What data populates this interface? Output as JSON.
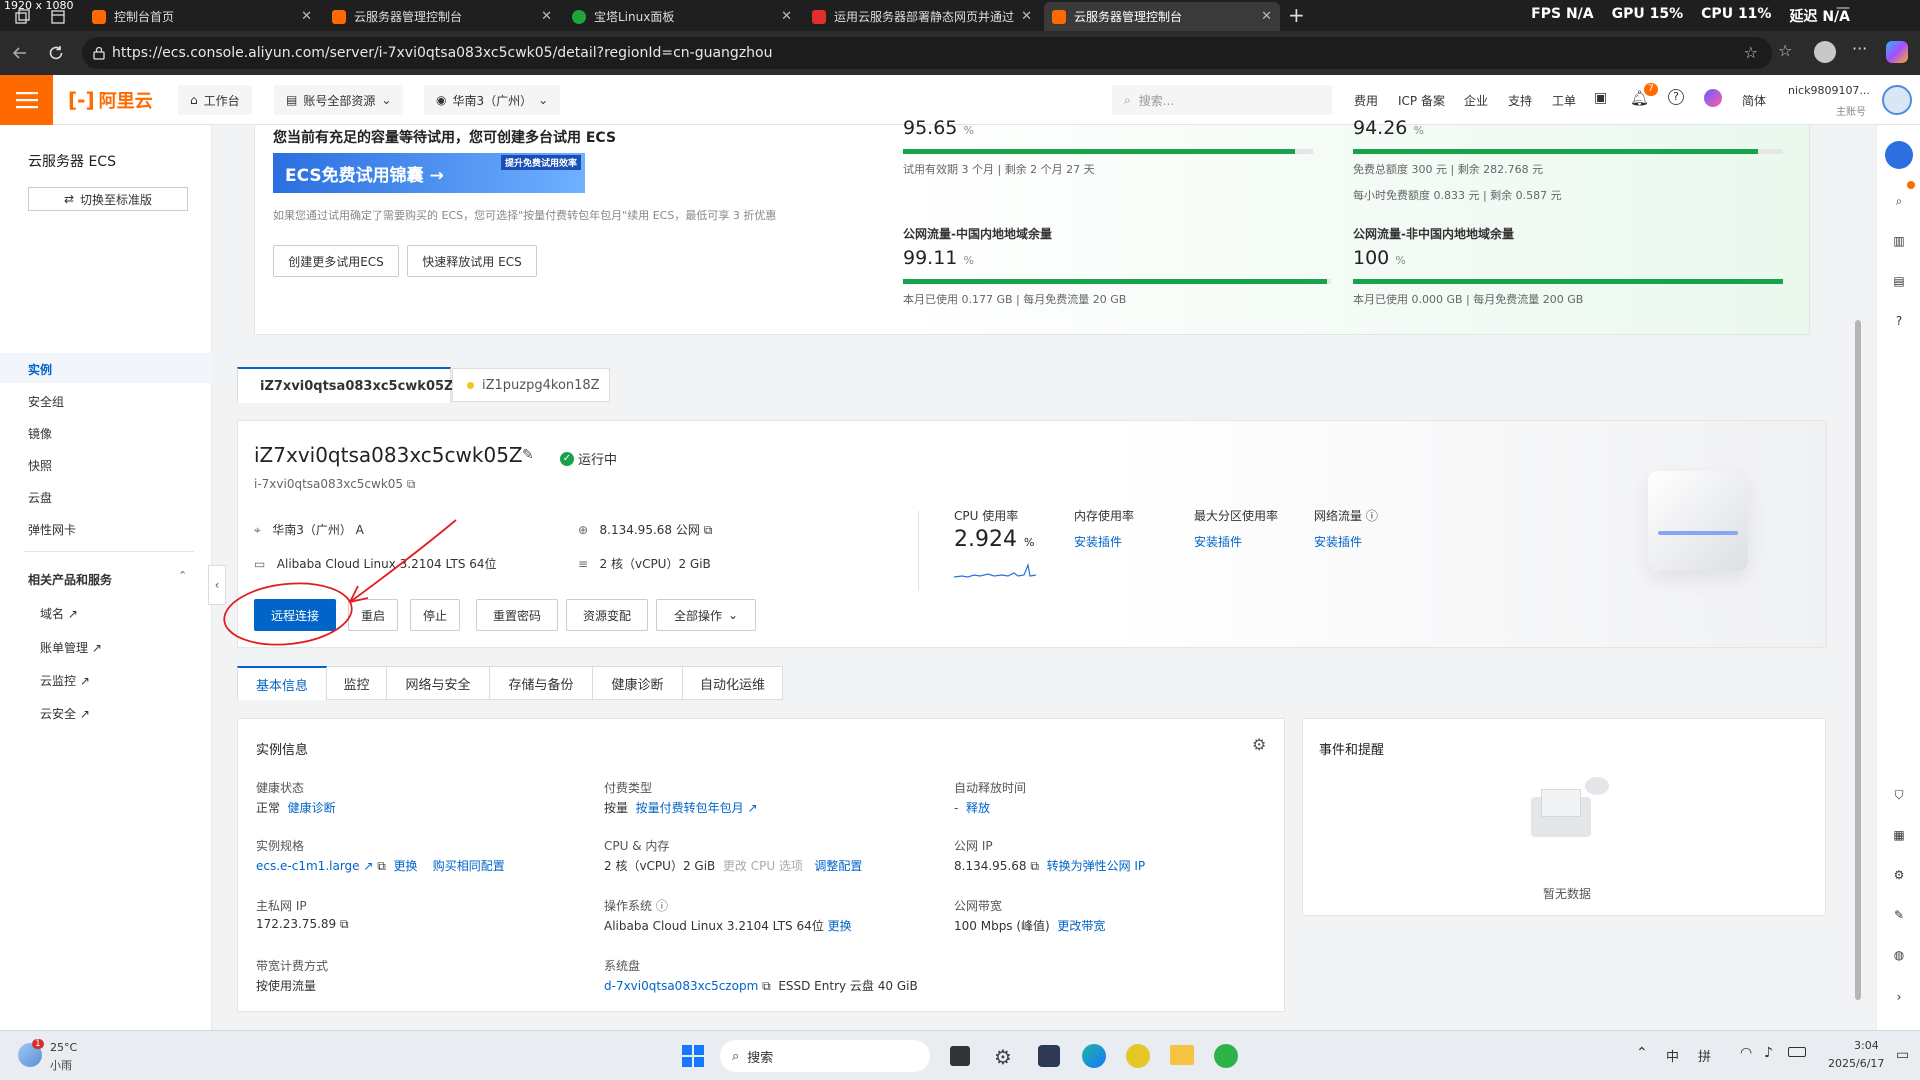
{
  "browser": {
    "overlay_dims": "1920 x 1080",
    "tabs": [
      {
        "title": "控制台首页",
        "color": "#ff6a00"
      },
      {
        "title": "云服务器管理控制台",
        "color": "#ff6a00"
      },
      {
        "title": "宝塔Linux面板",
        "color": "#20a53a"
      },
      {
        "title": "运用云服务器部署静态网页并通过...",
        "color": "#e0302e"
      },
      {
        "title": "云服务器管理控制台",
        "color": "#ff6a00"
      }
    ],
    "perf": {
      "fps_label": "FPS",
      "fps": "N/A",
      "gpu_label": "GPU",
      "gpu": "15%",
      "cpu_label": "CPU",
      "cpu": "11%",
      "lat_label": "延迟",
      "lat": "N/A"
    },
    "url": "https://ecs.console.aliyun.com/server/i-7xvi0qtsa083xc5cwk05/detail?regionId=cn-guangzhou"
  },
  "header": {
    "logo": "阿里云",
    "workbench": "工作台",
    "resources": "账号全部资源",
    "region": "华南3（广州）",
    "search_placeholder": "搜索...",
    "nav": [
      "费用",
      "ICP 备案",
      "企业",
      "支持",
      "工单"
    ],
    "bell_count": "7",
    "lang": "简体",
    "user": "nick9809107...",
    "user_role": "主账号"
  },
  "sidebar": {
    "title": "云服务器 ECS",
    "switch_btn": "切换至标准版",
    "items": [
      "实例",
      "安全组",
      "镜像",
      "快照",
      "云盘",
      "弹性网卡"
    ],
    "related_title": "相关产品和服务",
    "related": [
      "域名",
      "账单管理",
      "云监控",
      "云安全"
    ]
  },
  "trial": {
    "heading": "您当前有充足的容量等待试用，您可创建多台试用 ECS",
    "banner": "ECS免费试用锦囊 →",
    "banner_tag": "提升免费试用效率",
    "note": "如果您通过试用确定了需要购买的 ECS，您可选择\"按量付费转包年包月\"续用 ECS，最低可享 3 折优惠",
    "btn_create": "创建更多试用ECS",
    "btn_release": "快速释放试用 ECS",
    "stats": [
      {
        "title": "",
        "value": "95.65",
        "unit": "%",
        "progress": 0.9565,
        "sub": "试用有效期 3 个月 | 剩余 2 个月 27 天",
        "sub2": ""
      },
      {
        "title": "",
        "value": "94.26",
        "unit": "%",
        "progress": 0.9426,
        "sub": "免费总额度 300 元 | 剩余 282.768 元",
        "sub2": "每小时免费额度 0.833 元 | 剩余 0.587 元"
      },
      {
        "title": "公网流量-中国内地地域余量",
        "value": "99.11",
        "unit": "%",
        "progress": 0.9911,
        "sub": "本月已使用 0.177 GB | 每月免费流量 20 GB",
        "sub2": ""
      },
      {
        "title": "公网流量-非中国内地地域余量",
        "value": "100",
        "unit": "%",
        "progress": 1.0,
        "sub": "本月已使用 0.000 GB | 每月免费流量 200 GB",
        "sub2": ""
      }
    ]
  },
  "instance_tabs": [
    {
      "id": "iZ7xvi0qtsa083xc5cwk05Z",
      "status_color": "#16a34a"
    },
    {
      "id": "iZ1puzpg4kon18Z",
      "status_color": "#f5c518"
    }
  ],
  "instance": {
    "name": "iZ7xvi0qtsa083xc5cwk05Z",
    "status": "运行中",
    "id": "i-7xvi0qtsa083xc5cwk05",
    "zone": "华南3（广州） A",
    "ip": "8.134.95.68 公网",
    "os": "Alibaba Cloud Linux 3.2104 LTS 64位",
    "spec": "2 核（vCPU）2 GiB",
    "actions": [
      "远程连接",
      "重启",
      "停止",
      "重置密码",
      "资源变配",
      "全部操作"
    ],
    "metrics": {
      "cpu_label": "CPU 使用率",
      "cpu_value": "2.924",
      "cpu_unit": "%",
      "mem_label": "内存使用率",
      "disk_label": "最大分区使用率",
      "net_label": "网络流量",
      "install": "安装插件"
    }
  },
  "detail_tabs": [
    "基本信息",
    "监控",
    "网络与安全",
    "存储与备份",
    "健康诊断",
    "自动化运维"
  ],
  "info": {
    "title": "实例信息",
    "health_label": "健康状态",
    "health_value": "正常",
    "health_link": "健康诊断",
    "pay_label": "付费类型",
    "pay_value": "按量",
    "pay_link": "按量付费转包年包月",
    "release_label": "自动释放时间",
    "release_value": "-",
    "release_link": "释放",
    "spec_label": "实例规格",
    "spec_value": "ecs.e-c1m1.large",
    "spec_link1": "更换",
    "spec_link2": "购买相同配置",
    "cpu_label": "CPU & 内存",
    "cpu_value": "2 核（vCPU）2 GiB",
    "cpu_gray": "更改 CPU 选项",
    "cpu_link": "调整配置",
    "pubip_label": "公网 IP",
    "pubip_value": "8.134.95.68",
    "pubip_link": "转换为弹性公网 IP",
    "priv_label": "主私网 IP",
    "priv_value": "172.23.75.89",
    "os_label": "操作系统",
    "os_value": "Alibaba Cloud Linux 3.2104 LTS 64位",
    "os_link": "更换",
    "bw_label": "公网带宽",
    "bw_value": "100 Mbps (峰值)",
    "bw_link": "更改带宽",
    "bwm_label": "带宽计费方式",
    "bwm_value": "按使用流量",
    "disk_label": "系统盘",
    "disk_value": "d-7xvi0qtsa083xc5czopm",
    "disk_tail": "ESSD Entry 云盘 40 GiB"
  },
  "events": {
    "title": "事件和提醒",
    "empty": "暂无数据"
  },
  "taskbar": {
    "temp": "25°C",
    "weather": "小雨",
    "weather_badge": "1",
    "search": "搜索",
    "ime1": "中",
    "ime2": "拼",
    "time": "3:04",
    "date": "2025/6/17"
  }
}
